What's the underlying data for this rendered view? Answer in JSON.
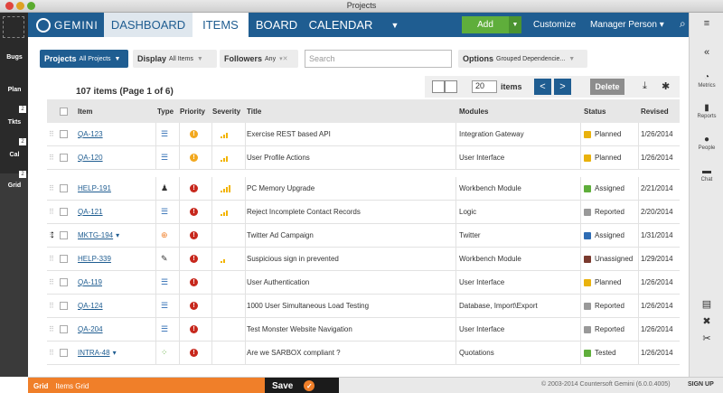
{
  "window": {
    "title": "Projects"
  },
  "left_rail": {
    "tabs": [
      {
        "label": "Bugs",
        "color": "#c2408d",
        "badge": ""
      },
      {
        "label": "Plan",
        "color": "#d83a2e",
        "badge": "2"
      },
      {
        "label": "Tkts",
        "color": "#2e6cb4",
        "badge": "2"
      },
      {
        "label": "Cal",
        "color": "#2b6a4a",
        "badge": "2"
      },
      {
        "label": "Grid",
        "color": "#f07f29",
        "badge": ""
      }
    ]
  },
  "nav": {
    "logo": "GEMINI",
    "tabs": [
      "DASHBOARD",
      "ITEMS",
      "BOARD",
      "CALENDAR"
    ],
    "active_tab": "ITEMS",
    "add_label": "Add",
    "customize_label": "Customize",
    "user_label": "Manager Person"
  },
  "right_rail": {
    "items": [
      "Metrics",
      "Reports",
      "People",
      "Chat"
    ]
  },
  "filters": {
    "projects_label": "Projects",
    "projects_value": "All Projects",
    "display_label": "Display",
    "display_value": "All Items",
    "followers_label": "Followers",
    "followers_value": "Any",
    "search_placeholder": "Search",
    "options_label": "Options",
    "options_value": "Grouped Dependencie..."
  },
  "toolbar": {
    "count_text": "107 items (Page 1 of 6)",
    "page_size": "20",
    "items_label": "items",
    "prev": "<",
    "next": ">",
    "delete_label": "Delete"
  },
  "table": {
    "columns": [
      "Item",
      "Type",
      "Priority",
      "Severity",
      "Title",
      "Modules",
      "Status",
      "Revised"
    ],
    "rows": [
      {
        "item": "QA-123",
        "caret": "",
        "type": "list-icon",
        "priority": "#f2a81f",
        "severity": 3,
        "title": "Exercise REST based API",
        "modules": "Integration Gateway",
        "status": "Planned",
        "status_color": "#e9b20d",
        "revised": "1/26/2014"
      },
      {
        "item": "QA-120",
        "caret": "",
        "type": "list-icon",
        "priority": "#f2a81f",
        "severity": 3,
        "title": "User Profile Actions",
        "modules": "User Interface",
        "status": "Planned",
        "status_color": "#e9b20d",
        "revised": "1/26/2014"
      },
      {
        "item": "HELP-191",
        "caret": "",
        "type": "user-icon",
        "priority": "#c7281d",
        "severity": 4,
        "title": "PC Memory Upgrade",
        "modules": "Workbench Module",
        "status": "Assigned",
        "status_color": "#5fae3b",
        "revised": "2/21/2014"
      },
      {
        "item": "QA-121",
        "caret": "",
        "type": "list-icon",
        "priority": "#c7281d",
        "severity": 3,
        "title": "Reject Incomplete Contact Records",
        "modules": "Logic",
        "status": "Reported",
        "status_color": "#999999",
        "revised": "2/20/2014"
      },
      {
        "item": "MKTG-194",
        "caret": "▾",
        "type": "plus-icon",
        "priority": "#c7281d",
        "severity": 0,
        "title": "Twitter Ad Campaign",
        "modules": "Twitter",
        "status": "Assigned",
        "status_color": "#2e6cb4",
        "revised": "1/31/2014"
      },
      {
        "item": "HELP-339",
        "caret": "",
        "type": "pin-icon",
        "priority": "#c7281d",
        "severity": 2,
        "title": "Suspicious sign in prevented",
        "modules": "Workbench Module",
        "status": "Unassigned",
        "status_color": "#7a3a2e",
        "revised": "1/29/2014"
      },
      {
        "item": "QA-119",
        "caret": "",
        "type": "list-icon",
        "priority": "#c7281d",
        "severity": 0,
        "title": "User Authentication",
        "modules": "User Interface",
        "status": "Planned",
        "status_color": "#e9b20d",
        "revised": "1/26/2014"
      },
      {
        "item": "QA-124",
        "caret": "",
        "type": "list-icon",
        "priority": "#c7281d",
        "severity": 0,
        "title": "1000 User Simultaneous Load Testing",
        "modules": "Database, Import\\Export",
        "status": "Reported",
        "status_color": "#999999",
        "revised": "1/26/2014"
      },
      {
        "item": "QA-204",
        "caret": "",
        "type": "list-icon",
        "priority": "#c7281d",
        "severity": 0,
        "title": "Test Monster Website Navigation",
        "modules": "User Interface",
        "status": "Reported",
        "status_color": "#999999",
        "revised": "1/26/2014"
      },
      {
        "item": "INTRA-48",
        "caret": "▾",
        "type": "tree-icon",
        "priority": "#c7281d",
        "severity": 0,
        "title": "Are we SARBOX compliant ?",
        "modules": "Quotations",
        "status": "Tested",
        "status_color": "#5fae3b",
        "revised": "1/26/2014"
      }
    ]
  },
  "footer": {
    "context": "Grid",
    "context_detail": "Items Grid",
    "save_label": "Save",
    "copyright": "© 2003-2014 Countersoft Gemini (6.0.0.4005)",
    "signup": "SIGN UP"
  }
}
